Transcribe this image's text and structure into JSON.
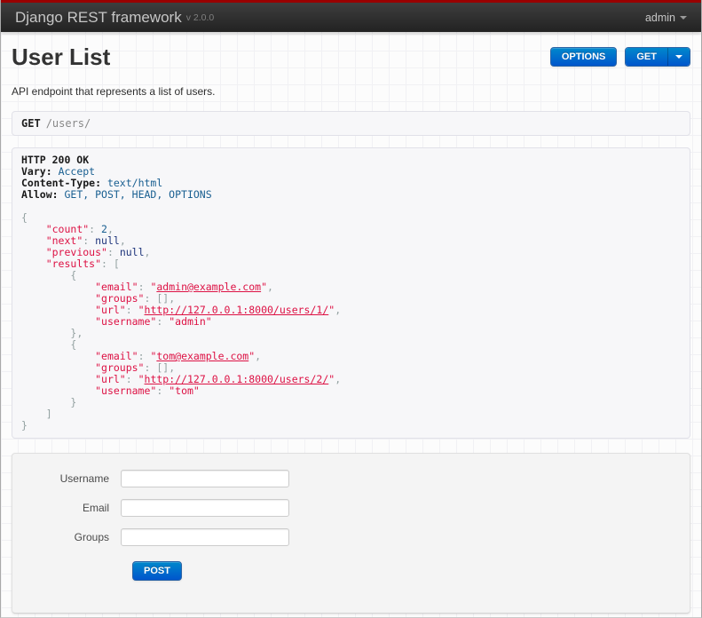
{
  "navbar": {
    "brand": "Django REST framework",
    "version": "v 2.0.0",
    "user": "admin"
  },
  "header": {
    "title": "User List",
    "description": "API endpoint that represents a list of users.",
    "options_label": "OPTIONS",
    "get_label": "GET"
  },
  "request_bar": {
    "method": "GET",
    "path": "/users/"
  },
  "response": {
    "status_line": "HTTP 200 OK",
    "headers": [
      {
        "name": "Vary:",
        "value": "Accept"
      },
      {
        "name": "Content-Type:",
        "value": "text/html"
      },
      {
        "name": "Allow:",
        "value": "GET, POST, HEAD, OPTIONS"
      }
    ],
    "body": {
      "count": 2,
      "next": null,
      "previous": null,
      "results": [
        {
          "email": "admin@example.com",
          "groups": [],
          "url": "http://127.0.0.1:8000/users/1/",
          "username": "admin"
        },
        {
          "email": "tom@example.com",
          "groups": [],
          "url": "http://127.0.0.1:8000/users/2/",
          "username": "tom"
        }
      ]
    }
  },
  "form": {
    "fields": [
      {
        "label": "Username",
        "value": ""
      },
      {
        "label": "Email",
        "value": ""
      },
      {
        "label": "Groups",
        "value": ""
      }
    ],
    "submit_label": "POST"
  },
  "colors": {
    "accent_blue_top": "#0088cc",
    "accent_blue_bottom": "#0055cc",
    "navbar_red": "#990000",
    "json_string": "#DD1144",
    "json_literal": "#195f91",
    "json_keyword": "#1E347B",
    "json_punctuation": "#93a1a1"
  }
}
